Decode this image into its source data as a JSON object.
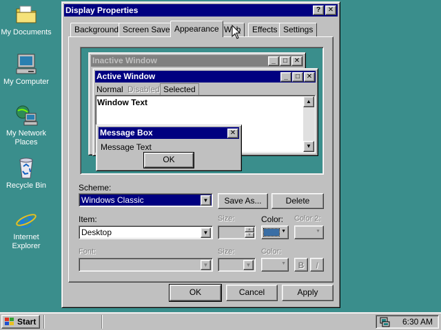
{
  "desktop": {
    "icons": [
      {
        "label": "My Documents",
        "icon": "folder-icon"
      },
      {
        "label": "My Computer",
        "icon": "computer-icon"
      },
      {
        "label": "My Network Places",
        "icon": "network-icon"
      },
      {
        "label": "Recycle Bin",
        "icon": "recycle-bin-icon"
      },
      {
        "label": "Internet Explorer",
        "icon": "ie-icon"
      }
    ]
  },
  "dialog": {
    "title": "Display Properties",
    "help_btn": "?",
    "close_btn": "✕",
    "tabs": [
      "Background",
      "Screen Saver",
      "Appearance",
      "Web",
      "Effects",
      "Settings"
    ],
    "active_tab": "Appearance",
    "preview": {
      "inactive_title": "Inactive Window",
      "active_title": "Active Window",
      "menu": [
        "Normal",
        "Disabled",
        "Selected"
      ],
      "window_text": "Window Text",
      "msgbox_title": "Message Box",
      "msgbox_text": "Message Text",
      "msgbox_ok": "OK"
    },
    "scheme_label": "Scheme:",
    "scheme_value": "Windows Classic",
    "save_as": "Save As...",
    "delete": "Delete",
    "item_label": "Item:",
    "item_value": "Desktop",
    "size_label": "Size:",
    "color_label": "Color:",
    "color2_label": "Color 2:",
    "font_label": "Font:",
    "font_size_label": "Size:",
    "font_color_label": "Color:",
    "bold_btn": "B",
    "italic_btn": "I",
    "ok": "OK",
    "cancel": "Cancel",
    "apply": "Apply"
  },
  "taskbar": {
    "start": "Start",
    "clock": "6:30 AM"
  },
  "colors": {
    "desktop": "#3a8e8c",
    "active_title": "#000080",
    "inactive_title": "#808080",
    "face": "#c0c0c0"
  }
}
